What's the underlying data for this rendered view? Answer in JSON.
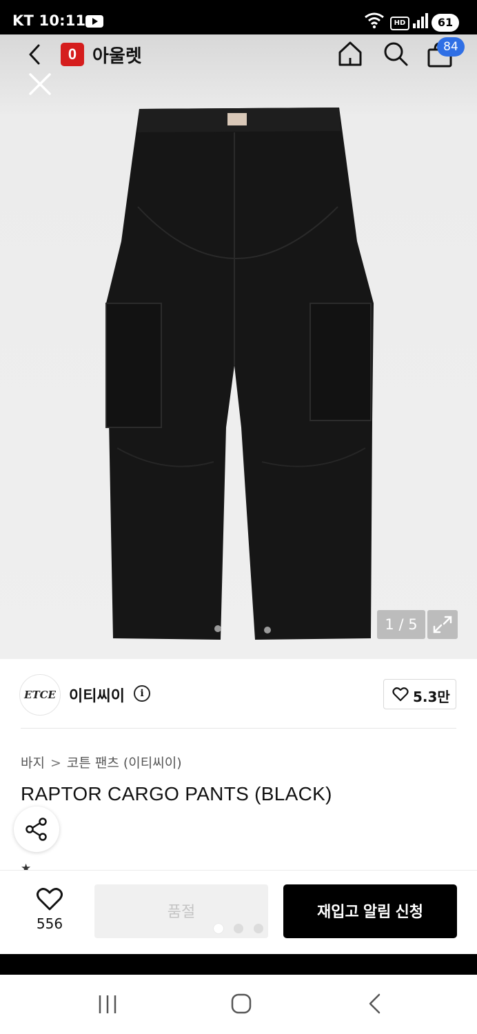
{
  "status_bar": {
    "carrier_time": "KT 10:11",
    "battery": "61",
    "hd_label": "HD"
  },
  "header": {
    "logo_text": "0",
    "app_title": "아울렛",
    "bag_count": "84"
  },
  "hero": {
    "page_indicator": "1 / 5"
  },
  "brand": {
    "logo_text": "ETCE",
    "name": "이티씨이",
    "info_glyph": "i",
    "like_count": "5.3만"
  },
  "breadcrumb": {
    "category": "바지",
    "separator": ">",
    "subcategory": "코튼 팬츠 (이티씨이)"
  },
  "product": {
    "title": "RAPTOR CARGO PANTS (BLACK)"
  },
  "action_bar": {
    "wish_count": "556",
    "soldout_label": "품절",
    "notify_label": "재입고 알림 신청"
  },
  "colors": {
    "brand_red": "#d51d1d",
    "badge_blue": "#2f6fe5",
    "cta_black": "#000000"
  }
}
